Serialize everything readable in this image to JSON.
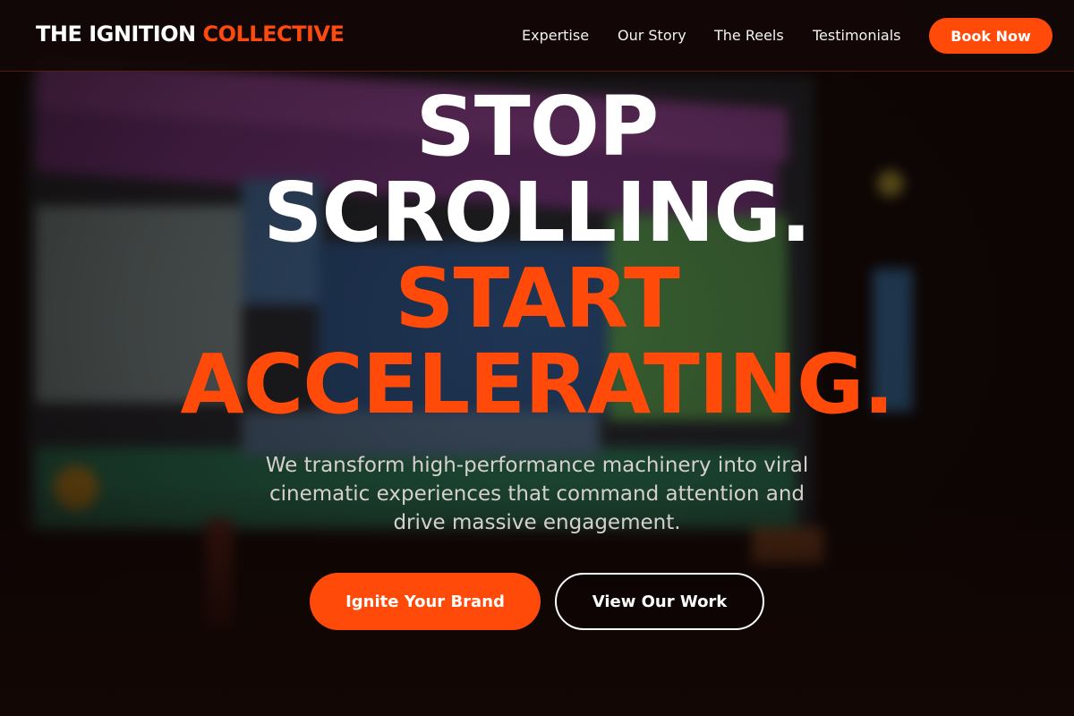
{
  "brand": {
    "part1": "THE IGNITION",
    "part2": "COLLECTIVE"
  },
  "nav": {
    "links": [
      {
        "label": "Expertise"
      },
      {
        "label": "Our Story"
      },
      {
        "label": "The Reels"
      },
      {
        "label": "Testimonials"
      }
    ],
    "cta_label": "Book Now"
  },
  "hero": {
    "line1": "STOP",
    "line2": "SCROLLING.",
    "line3": "START",
    "line4": "ACCELERATING.",
    "subtitle": "We transform high-performance machinery into viral cinematic experiences that command attention and drive massive engagement.",
    "primary_cta": "Ignite Your Brand",
    "secondary_cta": "View Our Work"
  },
  "colors": {
    "accent": "#ff4a0a",
    "background": "#120806",
    "text": "#ffffff"
  }
}
